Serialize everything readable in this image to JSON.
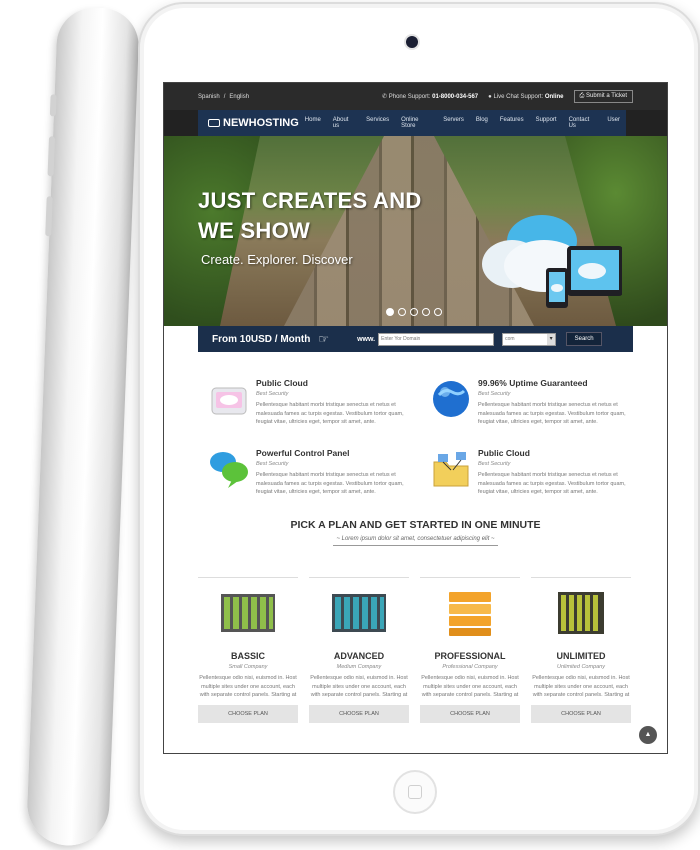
{
  "topbar": {
    "lang_1": "Spanish",
    "lang_sep": "/",
    "lang_2": "English",
    "phone_label": "Phone Support",
    "phone_number": "01-8000-034-567",
    "chat_label": "Live Chat Support",
    "chat_status": "Online",
    "ticket_label": "Submit a Ticket"
  },
  "nav": {
    "logo": "NEWHOSTING",
    "items": [
      "Home",
      "About us",
      "Services",
      "Online Store",
      "Servers",
      "Blog",
      "Features",
      "Support",
      "Contact Us",
      "User"
    ]
  },
  "hero": {
    "headline_1": "JUST CREATES AND",
    "headline_2": "WE SHOW",
    "tagline": "Create. Explorer. Discover"
  },
  "domain": {
    "price": "From 10USD / Month",
    "www": "www.",
    "placeholder": "Enter Yor Domain",
    "tld": "com",
    "search": "Search"
  },
  "features": [
    {
      "title": "Public Cloud",
      "subtitle": "Best Security",
      "text": "Pellentesque habitant morbi tristique senectus et netus et malesuada fames ac turpis egestas. Vestibulum tortor quam, feugiat vitae, ultricies eget, tempor sit amet, ante."
    },
    {
      "title": "99.96% Uptime Guaranteed",
      "subtitle": "Best Security",
      "text": "Pellentesque habitant morbi tristique senectus et netus et malesuada fames ac turpis egestas. Vestibulum tortor quam, feugiat vitae, ultricies eget, tempor sit amet, ante."
    },
    {
      "title": "Powerful Control Panel",
      "subtitle": "Best Security",
      "text": "Pellentesque habitant morbi tristique senectus et netus et malesuada fames ac turpis egestas. Vestibulum tortor quam, feugiat vitae, ultricies eget, tempor sit amet, ante."
    },
    {
      "title": "Public Cloud",
      "subtitle": "Best Security",
      "text": "Pellentesque habitant morbi tristique senectus et netus et malesuada fames ac turpis egestas. Vestibulum tortor quam, feugiat vitae, ultricies eget, tempor sit amet, ante."
    }
  ],
  "plans_header": {
    "title": "PICK A PLAN AND GET STARTED IN ONE MINUTE",
    "subtitle": "~ Lorem ipsum dolor sit amet, consectetuer adipiscing elit ~"
  },
  "plans": [
    {
      "name": "BASSIC",
      "subtitle": "Small Company",
      "text": "Pellentesque odio nisi, euismod in. Host multiple sites under one account, each with separate control panels. Starting at",
      "button": "CHOOSE PLAN",
      "color": "#8fbf4a"
    },
    {
      "name": "ADVANCED",
      "subtitle": "Medium Company",
      "text": "Pellentesque odio nisi, euismod in. Host multiple sites under one account, each with separate control panels. Starting at",
      "button": "CHOOSE PLAN",
      "color": "#3aa6b8"
    },
    {
      "name": "PROFESSIONAL",
      "subtitle": "Professional Company",
      "text": "Pellentesque odio nisi, euismod in. Host multiple sites under one account, each with separate control panels. Starting at",
      "button": "CHOOSE PLAN",
      "color": "#f3a32a"
    },
    {
      "name": "UNLIMITED",
      "subtitle": "Unlimited Company",
      "text": "Pellentesque odio nisi, euismod in. Host multiple sites under one account, each with separate control panels. Starting at",
      "button": "CHOOSE PLAN",
      "color": "#b8c23a"
    }
  ],
  "colors": {
    "nav_bg": "#1d3352",
    "search_bg": "#1b2f4b",
    "topbar_bg": "#2b2b2b"
  }
}
